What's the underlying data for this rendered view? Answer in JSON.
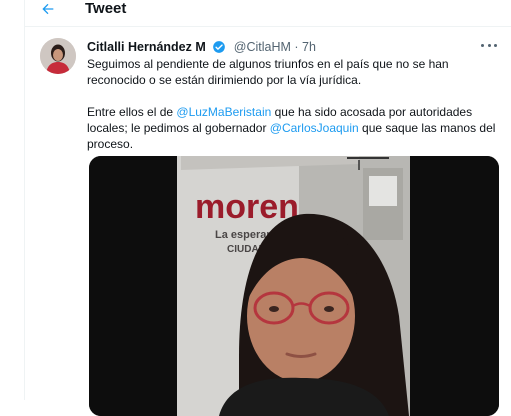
{
  "header": {
    "title": "Tweet"
  },
  "tweet": {
    "author_name": "Citlalli Hernández M",
    "handle": "@CitlaHM",
    "separator": "·",
    "time": "7h",
    "paragraph1": "Seguimos al pendiente de algunos triunfos en el país que no se han reconocido o se están dirimiendo por la vía jurídica.",
    "p2_part1": "Entre ellos el de ",
    "mention1": "@LuzMaBeristain",
    "p2_part2": " que ha sido acosada por autoridades locales; le pedimos al gobernador ",
    "mention2": "@CarlosJoaquin",
    "p2_part3": " que saque las manos del proceso."
  },
  "video": {
    "sign_word": "moren",
    "sign_line1": "La esperanz",
    "sign_line2": "CIUDAD"
  },
  "colors": {
    "accent": "#1d9bf0",
    "text": "#0f1419",
    "secondary": "#536471",
    "morena": "#9b1c2b"
  },
  "icons": {
    "back": "arrow-left-icon",
    "verified": "verified-badge-icon",
    "more": "more-horizontal-icon"
  }
}
